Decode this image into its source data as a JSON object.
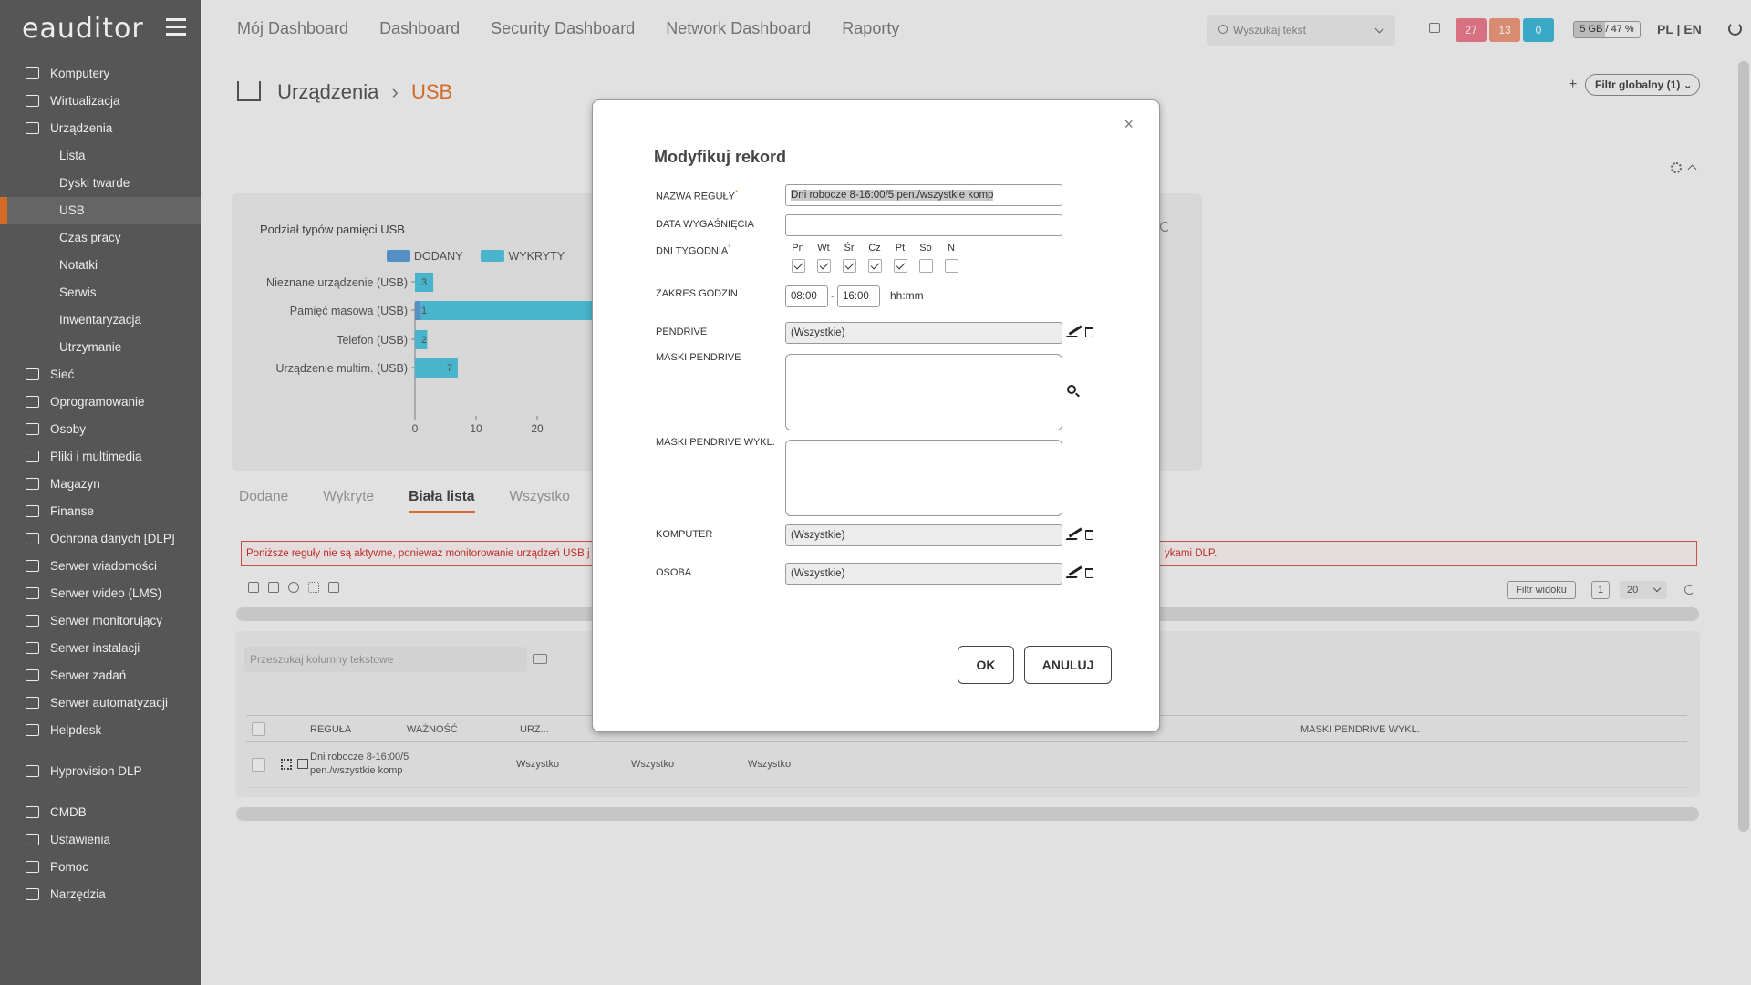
{
  "app": {
    "logo": "eauditor"
  },
  "sidebar": {
    "items": [
      {
        "label": "Komputery",
        "sub": false
      },
      {
        "label": "Wirtualizacja",
        "sub": false
      },
      {
        "label": "Urządzenia",
        "sub": false
      },
      {
        "label": "Lista",
        "sub": true
      },
      {
        "label": "Dyski twarde",
        "sub": true
      },
      {
        "label": "USB",
        "sub": true,
        "active": true
      },
      {
        "label": "Czas pracy",
        "sub": true
      },
      {
        "label": "Notatki",
        "sub": true
      },
      {
        "label": "Serwis",
        "sub": true
      },
      {
        "label": "Inwentaryzacja",
        "sub": true
      },
      {
        "label": "Utrzymanie",
        "sub": true
      },
      {
        "label": "Sieć",
        "sub": false
      },
      {
        "label": "Oprogramowanie",
        "sub": false
      },
      {
        "label": "Osoby",
        "sub": false
      },
      {
        "label": "Pliki i multimedia",
        "sub": false
      },
      {
        "label": "Magazyn",
        "sub": false
      },
      {
        "label": "Finanse",
        "sub": false
      },
      {
        "label": "Ochrona danych [DLP]",
        "sub": false
      },
      {
        "label": "Serwer wiadomości",
        "sub": false
      },
      {
        "label": "Serwer wideo (LMS)",
        "sub": false
      },
      {
        "label": "Serwer monitorujący",
        "sub": false
      },
      {
        "label": "Serwer instalacji",
        "sub": false
      },
      {
        "label": "Serwer zadań",
        "sub": false
      },
      {
        "label": "Serwer automatyzacji",
        "sub": false
      },
      {
        "label": "Helpdesk",
        "sub": false
      },
      {
        "label": "Hyprovision DLP",
        "sub": false,
        "gap": true
      },
      {
        "label": "CMDB",
        "sub": false,
        "gap": true
      },
      {
        "label": "Ustawienia",
        "sub": false
      },
      {
        "label": "Pomoc",
        "sub": false
      },
      {
        "label": "Narzędzia",
        "sub": false
      }
    ]
  },
  "topnav": [
    "Mój Dashboard",
    "Dashboard",
    "Security Dashboard",
    "Network Dashboard",
    "Raporty"
  ],
  "search": {
    "placeholder": "Wyszukaj tekst"
  },
  "badges": [
    {
      "value": "27",
      "color": "#e8798b"
    },
    {
      "value": "13",
      "color": "#e9967a"
    },
    {
      "value": "0",
      "color": "#3fb6d4"
    }
  ],
  "disk": {
    "label": "5 GB / 47 %",
    "fraction": 0.47
  },
  "lang": "PL | EN",
  "breadcrumb": {
    "parent": "Urządzenia",
    "current": "USB"
  },
  "filter_global": "Filtr globalny (1)",
  "chart_data": {
    "type": "bar",
    "orientation": "horizontal",
    "title": "Podział typów pamięci USB",
    "categories": [
      "Nieznane urządzenie (USB)",
      "Pamięć masowa (USB)",
      "Telefon (USB)",
      "Urządzenie multim. (USB)"
    ],
    "series": [
      {
        "name": "DODANY",
        "color": "#5b9bd5",
        "values": [
          0,
          1,
          0,
          0
        ]
      },
      {
        "name": "WYKRYTY",
        "color": "#4fc3dc",
        "values": [
          3,
          30,
          2,
          7
        ]
      }
    ],
    "data_labels": [
      "3",
      "1",
      "2",
      "7"
    ],
    "xticks": [
      "0",
      "10",
      "20"
    ],
    "xlim": [
      0,
      20
    ],
    "legend": "top"
  },
  "tabs": [
    {
      "label": "Dodane",
      "active": false
    },
    {
      "label": "Wykryte",
      "active": false
    },
    {
      "label": "Biała lista",
      "active": true
    },
    {
      "label": "Wszystko",
      "active": false
    }
  ],
  "warning": {
    "text": "Poniższe reguły nie są aktywne, ponieważ monitorowanie urządzeń USB j",
    "tail": "ykami DLP."
  },
  "toolbar": {
    "filter_view": "Filtr widoku",
    "page": "1",
    "per_page": "20"
  },
  "table": {
    "search_placeholder": "Przeszukaj kolumny tekstowe",
    "columns": [
      "REGUŁA",
      "WAŻNOŚĆ",
      "URZ...",
      "MASKI PENDRIVE WYKL."
    ],
    "rows": [
      {
        "rule_line1": "Dni robocze 8-16:00/5",
        "rule_line2": "pen./wszystkie komp",
        "c1": "Wszystko",
        "c2": "Wszystko",
        "c3": "Wszystko"
      }
    ]
  },
  "modal": {
    "title": "Modyfikuj rekord",
    "labels": {
      "name": "NAZWA REGUŁY",
      "expiry": "DATA WYGAŚNIĘCIA",
      "days": "DNI TYGODNIA",
      "hours": "ZAKRES GODZIN",
      "pendrive": "PENDRIVE",
      "masks": "MASKI PENDRIVE",
      "masks_excl": "MASKI PENDRIVE WYKL.",
      "computer": "KOMPUTER",
      "person": "OSOBA"
    },
    "name_value": "Dni robocze 8-16:00/5 pen./wszystkie komp",
    "expiry_value": "",
    "days": [
      {
        "label": "Pn",
        "checked": true
      },
      {
        "label": "Wt",
        "checked": true
      },
      {
        "label": "Śr",
        "checked": true
      },
      {
        "label": "Cz",
        "checked": true
      },
      {
        "label": "Pt",
        "checked": true
      },
      {
        "label": "So",
        "checked": false
      },
      {
        "label": "N",
        "checked": false
      }
    ],
    "time_from": "08:00",
    "time_to": "16:00",
    "time_format": "hh:mm",
    "pendrive_value": "(Wszystkie)",
    "computer_value": "(Wszystkie)",
    "person_value": "(Wszystkie)",
    "ok_label": "OK",
    "cancel_label": "ANULUJ"
  }
}
